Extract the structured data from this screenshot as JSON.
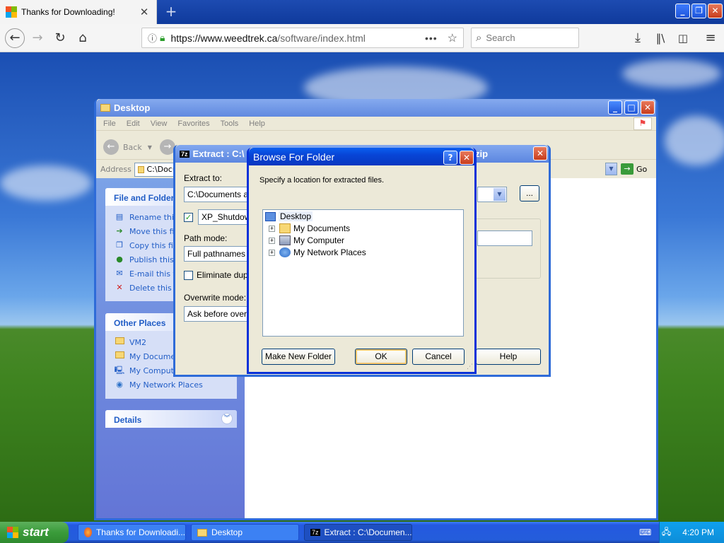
{
  "browser": {
    "tab_title": "Thanks for Downloading!",
    "url_host": "https://www.weedtrek.ca",
    "url_path": "/software/index.html",
    "url_more": "•••",
    "search_placeholder": "Search"
  },
  "explorer": {
    "title": "Desktop",
    "menu": [
      "File",
      "Edit",
      "View",
      "Favorites",
      "Tools",
      "Help"
    ],
    "back_label": "Back",
    "address_label": "Address",
    "address_value": "C:\\Docu",
    "go_label": "Go",
    "file_tasks": {
      "header": "File and Folder",
      "items": [
        "Rename this",
        "Move this file",
        "Copy this file",
        "Publish this f",
        "E-mail this fil",
        "Delete this fi"
      ]
    },
    "other_places": {
      "header": "Other Places",
      "items": [
        "VM2",
        "My Documen",
        "My Compute",
        "My Network Places"
      ]
    },
    "details": {
      "header": "Details"
    }
  },
  "extract": {
    "title": "Extract : C:\\",
    "title_tail": "zip",
    "extract_to_label": "Extract to:",
    "extract_to_value": "C:\\Documents and",
    "browse_label": "...",
    "folder_value": "XP_Shutdown",
    "path_mode_label": "Path mode:",
    "path_mode_value": "Full pathnames",
    "eliminate_label": "Eliminate duplic",
    "overwrite_label": "Overwrite mode:",
    "overwrite_value": "Ask before overw",
    "help_label": "Help"
  },
  "browse": {
    "title": "Browse For Folder",
    "help_btn": "?",
    "instruction": "Specify a location for extracted files.",
    "tree": {
      "root": "Desktop",
      "children": [
        "My Documents",
        "My Computer",
        "My Network Places"
      ]
    },
    "make_new_folder": "Make New Folder",
    "ok": "OK",
    "cancel": "Cancel"
  },
  "taskbar": {
    "start": "start",
    "items": [
      "Thanks for Downloadi...",
      "Desktop",
      "Extract : C:\\Documen..."
    ],
    "clock": "4:20 PM"
  }
}
